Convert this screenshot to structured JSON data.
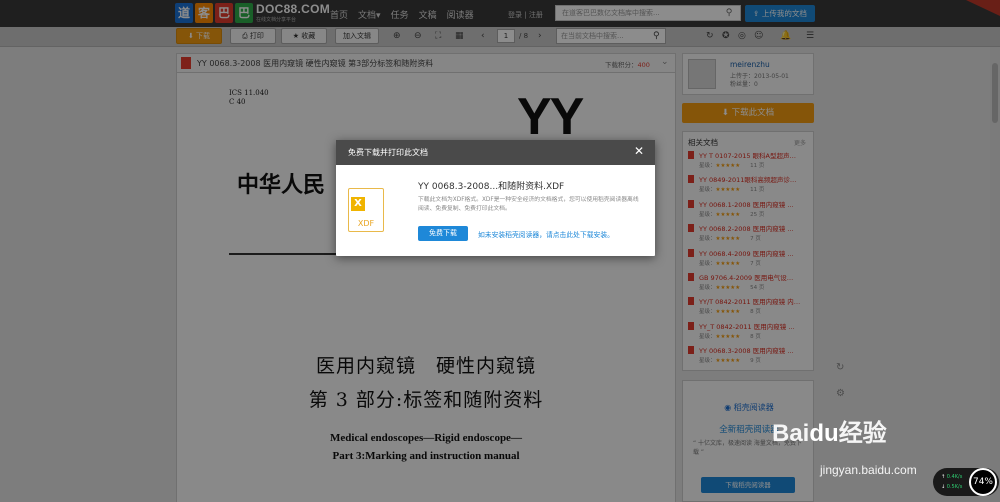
{
  "topnav": {
    "logo_chars": [
      "道",
      "客",
      "巴",
      "巴"
    ],
    "logo_text": "DOC88.COM",
    "logo_sub": "在线文档分享平台",
    "links": [
      "首页",
      "文档",
      "任务",
      "文稿",
      "阅读器"
    ],
    "docs_dropdown": "▾",
    "login": "登录",
    "divider": "|",
    "register": "注册",
    "search_placeholder": "在道客巴巴数亿文档库中搜索...",
    "upload_label": "上传我的文档"
  },
  "toolbar": {
    "download": "下载",
    "print": "打印",
    "favorite": "收藏",
    "add_to_list": "加入文辑",
    "page_current": "1",
    "page_total": "/ 8",
    "search_placeholder": "在当前文档中搜索..."
  },
  "doc": {
    "title": "YY 0068.3-2008 医用内窥镜 硬性内窥镜 第3部分标签和随附资料",
    "points_label": "下载积分：",
    "points_value": "400",
    "ics": "ICS 11.040",
    "ccs": "C 40",
    "logo": "YY",
    "std_head": "中华人民",
    "title_line1": "医用内窥镜　硬性内窥镜",
    "title_line2": "第 3 部分:标签和随附资料",
    "en_line1": "Medical endoscopes—Rigid endoscope—",
    "en_line2": "Part 3:Marking and instruction manual"
  },
  "user": {
    "name": "meirenzhu",
    "uploaded": "上传于：2013-05-01",
    "fans": "粉丝量：0"
  },
  "sidebar": {
    "download_doc": "下载此文档",
    "related_title": "相关文档",
    "more": "更多",
    "related": [
      {
        "title": "YY T 0107-2015 眼科A型超声…",
        "rating": "★★★★★",
        "pages": "11 页"
      },
      {
        "title": "YY 0849-2011眼科高频超声诊…",
        "rating": "★★★★★",
        "pages": "11 页"
      },
      {
        "title": "YY 0068.1-2008 医用内窥镜 …",
        "rating": "★★★★★",
        "pages": "25 页"
      },
      {
        "title": "YY 0068.2-2008 医用内窥镜 …",
        "rating": "★★★★★",
        "pages": "7 页"
      },
      {
        "title": "YY 0068.4-2009 医用内窥镜 …",
        "rating": "★★★★★",
        "pages": "7 页"
      },
      {
        "title": "GB 9706.4-2009 医用电气设…",
        "rating": "★★★★★",
        "pages": "54 页"
      },
      {
        "title": "YY/T 0842-2011 医用内窥镜 内…",
        "rating": "★★★★★",
        "pages": "8 页"
      },
      {
        "title": "YY_T 0842-2011 医用内窥镜 …",
        "rating": "★★★★★",
        "pages": "8 页"
      },
      {
        "title": "YY 0068.3-2008 医用内窥镜 …",
        "rating": "★★★★★",
        "pages": "9 页"
      }
    ],
    "rating_label": "星级：",
    "reader_logo": "稻壳阅读器",
    "reader_tag": "全新稻壳阅读器",
    "reader_desc": "“ 十亿文库，极速阅读 海量文档，免费下载 ”",
    "reader_btn": "下载稻壳阅读器"
  },
  "modal": {
    "title": "免费下载并打印此文档",
    "close": "✕",
    "file_name": "YY 0068.3-2008...和随附资料.XDF",
    "desc": "下载此文档为XDF格式。XDF是一种安全经济的文档格式，您可以使用稻壳阅读器离线阅读、免费复制、免费打印此文档。",
    "free_download": "免费下载",
    "install_link": "如未安装稻壳阅读器，请点击此处下载安装。",
    "xdf_label": "XDF",
    "xdf_letter": "X"
  },
  "watermark": {
    "brand": "Bai",
    "paw": "du",
    "brand_cn": "经验",
    "url": "jingyan.baidu.com"
  },
  "speed_widget": {
    "up": "0.4",
    "down": "0.5",
    "unit": "K/s",
    "percent": "74%"
  },
  "colors": {
    "nav_bg": "#3a3a3a",
    "accent_orange": "#f39c12",
    "accent_blue": "#1e88d8",
    "link_red": "#d8281c"
  }
}
